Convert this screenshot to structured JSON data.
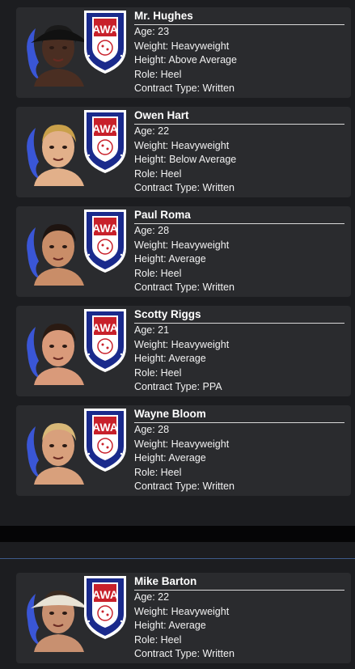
{
  "roster": [
    {
      "name": "Mr. Hughes",
      "age_label": "Age: 23",
      "weight_label": "Weight: Heavyweight",
      "height_label": "Height: Above Average",
      "role_label": "Role: Heel",
      "contract_label": "Contract Type: Written",
      "skin": "#4a2e22",
      "hair": "#1a1a1a",
      "hat": "#111111"
    },
    {
      "name": "Owen Hart",
      "age_label": "Age: 22",
      "weight_label": "Weight: Heavyweight",
      "height_label": "Height: Below Average",
      "role_label": "Role: Heel",
      "contract_label": "Contract Type: Written",
      "skin": "#e2b08a",
      "hair": "#c9a04a",
      "hat": ""
    },
    {
      "name": "Paul Roma",
      "age_label": "Age: 28",
      "weight_label": "Weight: Heavyweight",
      "height_label": "Height: Average",
      "role_label": "Role: Heel",
      "contract_label": "Contract Type: Written",
      "skin": "#c98d68",
      "hair": "#1e1410",
      "hat": ""
    },
    {
      "name": "Scotty Riggs",
      "age_label": "Age: 21",
      "weight_label": "Weight: Heavyweight",
      "height_label": "Height: Average",
      "role_label": "Role: Heel",
      "contract_label": "Contract Type: PPA",
      "skin": "#d99a7a",
      "hair": "#2a1a12",
      "hat": ""
    },
    {
      "name": "Wayne Bloom",
      "age_label": "Age: 28",
      "weight_label": "Weight: Heavyweight",
      "height_label": "Height: Average",
      "role_label": "Role: Heel",
      "contract_label": "Contract Type: Written",
      "skin": "#d8a07c",
      "hair": "#d8b878",
      "hat": ""
    }
  ],
  "roster_bottom": [
    {
      "name": "Mike Barton",
      "age_label": "Age: 22",
      "weight_label": "Weight: Heavyweight",
      "height_label": "Height: Average",
      "role_label": "Role: Heel",
      "contract_label": "Contract Type: Written",
      "skin": "#c89070",
      "hair": "#3a2a20",
      "hat": "#e8e2d4"
    }
  ],
  "logo": {
    "letters": "AWA",
    "ring_text": "American Wrestling Association"
  },
  "colors": {
    "splash": "#3a56d6",
    "shield_blue": "#1a2a8c",
    "shield_red": "#c8202a",
    "card_bg": "#2a2b2e",
    "page_bg": "#1c1d20"
  }
}
